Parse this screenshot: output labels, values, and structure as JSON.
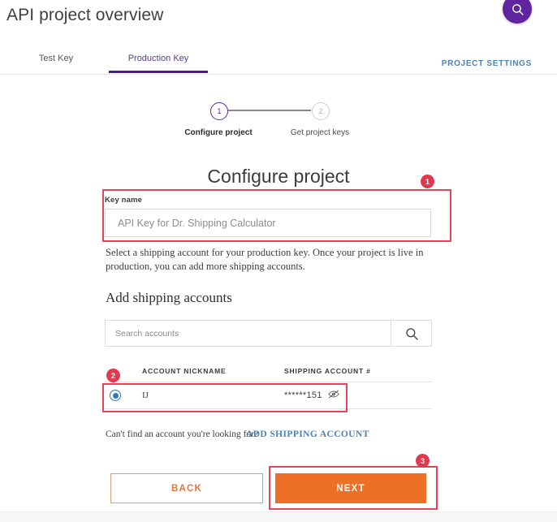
{
  "header": {
    "title": "API project overview",
    "search_icon": "search-icon"
  },
  "tabs": [
    {
      "label": "Test Key",
      "active": false
    },
    {
      "label": "Production Key",
      "active": true
    }
  ],
  "project_settings_link": "PROJECT SETTINGS",
  "stepper": {
    "steps": [
      {
        "number": "1",
        "label": "Configure project",
        "state": "active"
      },
      {
        "number": "2",
        "label": "Get project keys",
        "state": "inactive"
      }
    ]
  },
  "form": {
    "title": "Configure project",
    "key_name": {
      "label": "Key name",
      "value": "API Key for Dr. Shipping Calculator",
      "placeholder": "API Key for Dr. Shipping Calculator"
    },
    "helper_text": "Select a shipping account for your production key. Once your project is live in production, you can add more shipping accounts.",
    "section_heading": "Add shipping accounts",
    "search": {
      "value": "",
      "placeholder": "Search accounts",
      "button_icon": "search-icon"
    },
    "table": {
      "columns": [
        "ACCOUNT NICKNAME",
        "SHIPPING ACCOUNT #"
      ],
      "rows": [
        {
          "selected": true,
          "nickname": "IJ",
          "account_number": "******151",
          "visibility_icon": "eye-slash-icon"
        }
      ]
    },
    "find_help_text": "Can't find an account you're looking for?",
    "add_account_link": "ADD SHIPPING ACCOUNT",
    "buttons": {
      "back": "BACK",
      "next": "NEXT"
    }
  },
  "annotations": [
    {
      "badge": "1",
      "target": "key-name-field"
    },
    {
      "badge": "2",
      "target": "account-row"
    },
    {
      "badge": "3",
      "target": "next-button"
    }
  ],
  "colors": {
    "brand_purple": "#5f259f",
    "tab_underline": "#4a1a80",
    "link_blue": "#4a83b8",
    "radio_blue": "#2e77b8",
    "primary_orange": "#ee7026",
    "back_border": "#d9a078",
    "annotation_red": "#e8445a",
    "badge_red": "#e03a50"
  }
}
